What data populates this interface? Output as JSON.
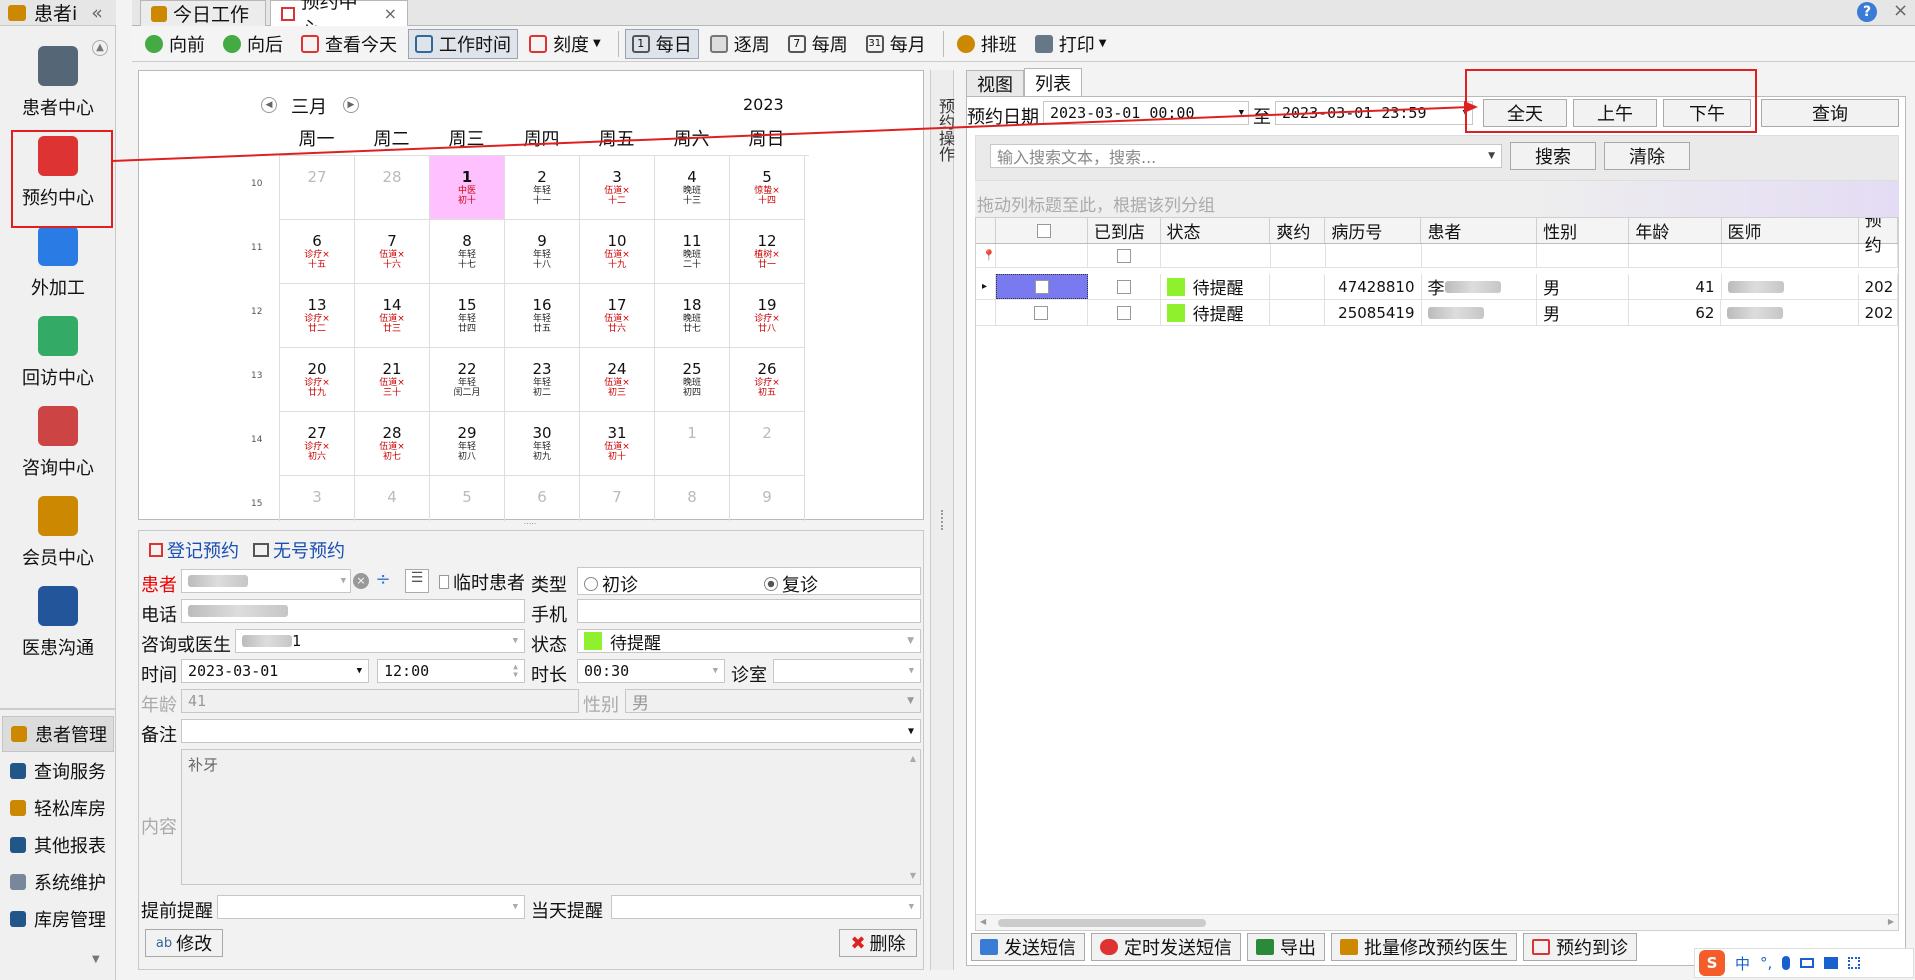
{
  "left_nav": {
    "title": "患者i",
    "collapse": "«",
    "big_items": [
      {
        "label": "患者中心",
        "icon": "binoculars-icon",
        "color": "#567"
      },
      {
        "label": "预约中心",
        "icon": "calendar-icon",
        "color": "#d33"
      },
      {
        "label": "外加工",
        "icon": "cubes-icon",
        "color": "#2a7be4"
      },
      {
        "label": "回访中心",
        "icon": "refresh-icon",
        "color": "#3a6"
      },
      {
        "label": "咨询中心",
        "icon": "consultant-icon",
        "color": "#c44"
      },
      {
        "label": "会员中心",
        "icon": "members-icon",
        "color": "#c80"
      },
      {
        "label": "医患沟通",
        "icon": "film-icon",
        "color": "#259"
      }
    ],
    "small_items": [
      {
        "label": "患者管理",
        "icon": "people-icon",
        "color": "#c80"
      },
      {
        "label": "查询服务",
        "icon": "search-icon",
        "color": "#258"
      },
      {
        "label": "轻松库房",
        "icon": "box-icon",
        "color": "#c80"
      },
      {
        "label": "其他报表",
        "icon": "report-icon",
        "color": "#258"
      },
      {
        "label": "系统维护",
        "icon": "gear-icon",
        "color": "#789"
      },
      {
        "label": "库房管理",
        "icon": "warehouse-icon",
        "color": "#258"
      }
    ]
  },
  "tabs": [
    {
      "label": "今日工作",
      "icon": "person-icon"
    },
    {
      "label": "预约中心",
      "icon": "calendar-icon",
      "close": "×"
    }
  ],
  "toolbar": {
    "items": [
      "向前",
      "向后",
      "查看今天",
      "工作时间",
      "刻度",
      "每日",
      "逐周",
      "每周",
      "每月",
      "排班",
      "打印"
    ]
  },
  "calendar": {
    "month": "三月",
    "year": "2023",
    "weekdays": [
      "周一",
      "周二",
      "周三",
      "周四",
      "周五",
      "周六",
      "周日"
    ],
    "weeknums": [
      "10",
      "11",
      "12",
      "13",
      "14",
      "15"
    ],
    "rows": [
      [
        {
          "d": "27",
          "o": true
        },
        {
          "d": "28",
          "o": true
        },
        {
          "d": "1",
          "s": "中医\n初十",
          "t": true
        },
        {
          "d": "2",
          "s": "年轻\n十一",
          "k": true
        },
        {
          "d": "3",
          "s": "伍道×\n十二"
        },
        {
          "d": "4",
          "s": "晚班\n十三",
          "k": true
        },
        {
          "d": "5",
          "s": "惊蛰×\n十四"
        }
      ],
      [
        {
          "d": "6",
          "s": "诊疗×\n十五"
        },
        {
          "d": "7",
          "s": "伍道×\n十六"
        },
        {
          "d": "8",
          "s": "年轻\n十七",
          "k": true
        },
        {
          "d": "9",
          "s": "年轻\n十八",
          "k": true
        },
        {
          "d": "10",
          "s": "伍道×\n十九"
        },
        {
          "d": "11",
          "s": "晚班\n二十",
          "k": true
        },
        {
          "d": "12",
          "s": "植树×\n廿一"
        }
      ],
      [
        {
          "d": "13",
          "s": "诊疗×\n廿二"
        },
        {
          "d": "14",
          "s": "伍道×\n廿三"
        },
        {
          "d": "15",
          "s": "年轻\n廿四",
          "k": true
        },
        {
          "d": "16",
          "s": "年轻\n廿五",
          "k": true
        },
        {
          "d": "17",
          "s": "伍道×\n廿六"
        },
        {
          "d": "18",
          "s": "晚班\n廿七",
          "k": true
        },
        {
          "d": "19",
          "s": "诊疗×\n廿八"
        }
      ],
      [
        {
          "d": "20",
          "s": "诊疗×\n廿九"
        },
        {
          "d": "21",
          "s": "伍道×\n三十"
        },
        {
          "d": "22",
          "s": "年轻\n闰二月",
          "k": true
        },
        {
          "d": "23",
          "s": "年轻\n初二",
          "k": true
        },
        {
          "d": "24",
          "s": "伍道×\n初三"
        },
        {
          "d": "25",
          "s": "晚班\n初四",
          "k": true
        },
        {
          "d": "26",
          "s": "诊疗×\n初五"
        }
      ],
      [
        {
          "d": "27",
          "s": "诊疗×\n初六"
        },
        {
          "d": "28",
          "s": "伍道×\n初七"
        },
        {
          "d": "29",
          "s": "年轻\n初八",
          "k": true
        },
        {
          "d": "30",
          "s": "年轻\n初九",
          "k": true
        },
        {
          "d": "31",
          "s": "伍道×\n初十"
        },
        {
          "d": "1",
          "o": true
        },
        {
          "d": "2",
          "o": true
        }
      ],
      [
        {
          "d": "3",
          "o": true
        },
        {
          "d": "4",
          "o": true
        },
        {
          "d": "5",
          "o": true
        },
        {
          "d": "6",
          "o": true
        },
        {
          "d": "7",
          "o": true
        },
        {
          "d": "8",
          "o": true
        },
        {
          "d": "9",
          "o": true
        }
      ]
    ]
  },
  "form": {
    "tab_register": "登记预约",
    "tab_nonumber": "无号预约",
    "patient_label": "患者",
    "temp_patient": "临时患者",
    "type_label": "类型",
    "type_first": "初诊",
    "type_revisit": "复诊",
    "phone_label": "电话",
    "mobile_label": "手机",
    "doctor_label": "咨询或医生",
    "doctor_value": "1",
    "status_label": "状态",
    "status_value": "待提醒",
    "time_label": "时间",
    "date_value": "2023-03-01",
    "time_value": "12:00",
    "duration_label": "时长",
    "duration_value": "00:30",
    "room_label": "诊室",
    "age_label": "年龄",
    "age_value": "41",
    "gender_label": "性别",
    "gender_value": "男",
    "note_label": "备注",
    "content_label": "内容",
    "content_value": "补牙",
    "advance_label": "提前提醒",
    "sameday_label": "当天提醒",
    "edit_btn": "修改",
    "delete_btn": "删除"
  },
  "side_vertical": "预约操作",
  "right": {
    "tabs": [
      "视图",
      "列表"
    ],
    "date_label": "预约日期",
    "date_from": "2023-03-01 00:00",
    "to_label": "至",
    "date_to": "2023-03-01 23:59",
    "btn_allday": "全天",
    "btn_am": "上午",
    "btn_pm": "下午",
    "btn_query": "查询",
    "search_placeholder": "输入搜索文本，搜索...",
    "btn_search": "搜索",
    "btn_clear": "清除",
    "group_hint": "拖动列标题至此，根据该列分组",
    "columns": [
      "",
      "已到店",
      "状态",
      "爽约",
      "病历号",
      "患者",
      "性别",
      "年龄",
      "医师",
      "预约"
    ],
    "rows": [
      {
        "status": "待提醒",
        "record": "47428810",
        "patient": "李",
        "gender": "男",
        "age": "41",
        "date": "202"
      },
      {
        "status": "待提醒",
        "record": "25085419",
        "patient": "",
        "gender": "男",
        "age": "62",
        "date": "202"
      }
    ],
    "footer": [
      "发送短信",
      "定时发送短信",
      "导出",
      "批量修改预约医生",
      "预约到诊"
    ]
  },
  "ime": {
    "logo": "S",
    "items": [
      "中",
      "°,",
      "🎤",
      "⌨",
      "👕",
      "▦"
    ]
  }
}
